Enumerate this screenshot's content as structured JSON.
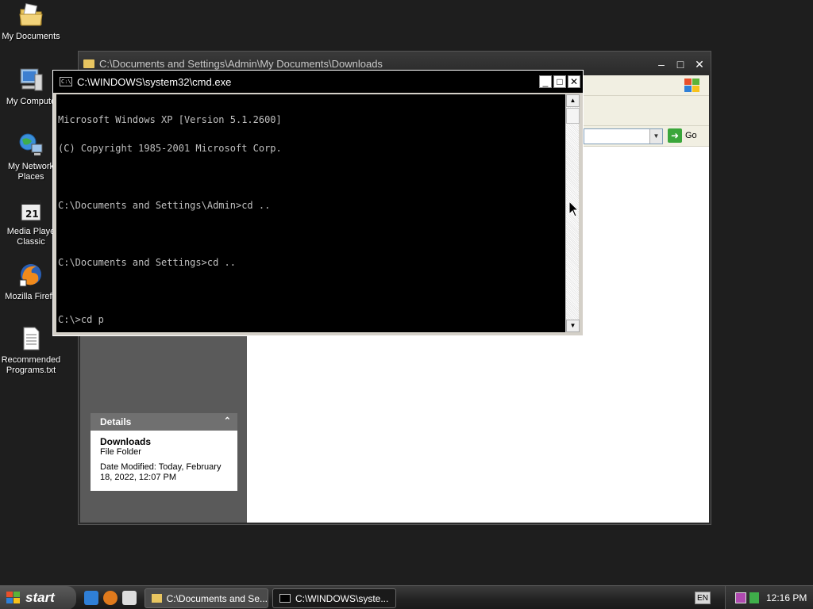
{
  "desktop": {
    "icons": [
      {
        "label": "My Documents"
      },
      {
        "label": "My Compute"
      },
      {
        "label": "My Network Places"
      },
      {
        "label": "Media Playe Classic"
      },
      {
        "label": "Mozilla Firefo"
      },
      {
        "label": "Recommended Programs.txt"
      }
    ]
  },
  "explorer": {
    "title": "C:\\Documents and Settings\\Admin\\My Documents\\Downloads",
    "go_label": "Go",
    "details": {
      "header": "Details",
      "name": "Downloads",
      "type": "File Folder",
      "date_modified": "Date Modified: Today, February 18, 2022, 12:07 PM"
    }
  },
  "cmd": {
    "title": "C:\\WINDOWS\\system32\\cmd.exe",
    "lines": [
      "Microsoft Windows XP [Version 5.1.2600]",
      "(C) Copyright 1985-2001 Microsoft Corp.",
      "",
      "C:\\Documents and Settings\\Admin>cd ..",
      "",
      "C:\\Documents and Settings>cd ..",
      "",
      "C:\\>cd p"
    ]
  },
  "taskbar": {
    "start_label": "start",
    "tasks": [
      {
        "label": "C:\\Documents and Se..."
      },
      {
        "label": "C:\\WINDOWS\\syste..."
      }
    ],
    "language": "EN",
    "clock": "12:16 PM"
  },
  "colors": {
    "desktop_bg": "#1e1e1e",
    "console_bg": "#000000",
    "console_fg": "#c0c0c0"
  }
}
